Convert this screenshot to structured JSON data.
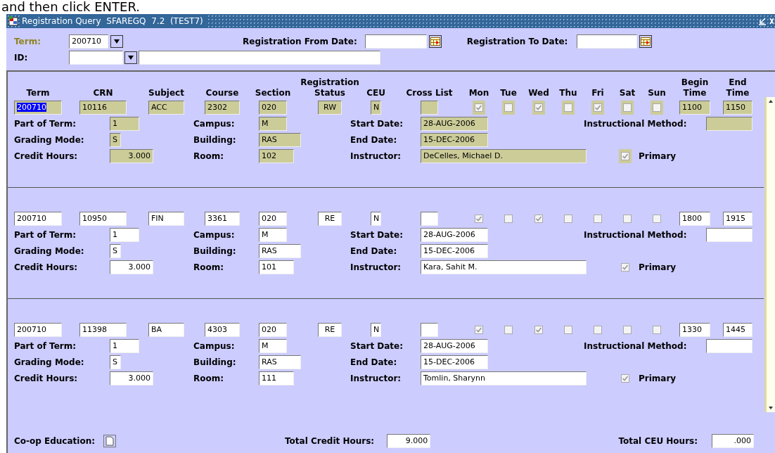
{
  "caption": "and then click ENTER.",
  "window": {
    "title": "Registration Query  SFAREGQ  7.2  (TEST7)"
  },
  "key_block": {
    "term_label": "Term:",
    "term": "200710",
    "id_label": "ID:",
    "from_date_label": "Registration From Date:",
    "to_date_label": "Registration To Date:"
  },
  "columns": [
    {
      "lines": [
        "Term"
      ]
    },
    {
      "lines": [
        "CRN"
      ]
    },
    {
      "lines": [
        "Subject"
      ]
    },
    {
      "lines": [
        "Course"
      ]
    },
    {
      "lines": [
        "Section"
      ]
    },
    {
      "lines": [
        "Registration",
        "Status"
      ]
    },
    {
      "lines": [
        "CEU"
      ]
    },
    {
      "lines": [
        "Cross List"
      ]
    },
    {
      "lines": [
        "Mon"
      ]
    },
    {
      "lines": [
        "Tue"
      ]
    },
    {
      "lines": [
        "Wed"
      ]
    },
    {
      "lines": [
        "Thu"
      ]
    },
    {
      "lines": [
        "Fri"
      ]
    },
    {
      "lines": [
        "Sat"
      ]
    },
    {
      "lines": [
        "Sun"
      ]
    },
    {
      "lines": [
        "Begin",
        "Time"
      ]
    },
    {
      "lines": [
        "End",
        "Time"
      ]
    }
  ],
  "records": [
    {
      "current": true,
      "term": "200710",
      "term_selected": true,
      "crn": "10116",
      "subject": "ACC",
      "course": "2302",
      "section": "020",
      "status": "RW",
      "ceu": "N",
      "days": [
        {
          "checked": true
        },
        {
          "checked": false
        },
        {
          "checked": true
        },
        {
          "checked": false
        },
        {
          "checked": true
        },
        {
          "checked": false
        },
        {
          "checked": false
        }
      ],
      "begin_time": "1100",
      "end_time": "1150",
      "part_of_term": {
        "label": "Part of Term:",
        "value": "1"
      },
      "campus": {
        "label": "Campus:",
        "value": "M"
      },
      "start_date": {
        "label": "Start Date:",
        "value": "28-AUG-2006"
      },
      "instructional_method": {
        "label": "Instructional Method:"
      },
      "grading_mode": {
        "label": "Grading Mode:",
        "value": "S"
      },
      "building": {
        "label": "Building:",
        "value": "RAS"
      },
      "end_date": {
        "label": "End Date:",
        "value": "15-DEC-2006"
      },
      "credit_hours": {
        "label": "Credit Hours:",
        "value": "3.000"
      },
      "room": {
        "label": "Room:",
        "value": "102"
      },
      "instructor": {
        "label": "Instructor:",
        "value": "DeCelles, Michael D."
      },
      "primary": {
        "label": "Primary",
        "checked": true
      }
    },
    {
      "current": false,
      "term": "200710",
      "term_selected": false,
      "crn": "10950",
      "subject": "FIN",
      "course": "3361",
      "section": "020",
      "status": "RE",
      "ceu": "N",
      "days": [
        {
          "checked": true
        },
        {
          "checked": false
        },
        {
          "checked": true
        },
        {
          "checked": false
        },
        {
          "checked": false
        },
        {
          "checked": false
        },
        {
          "checked": false
        }
      ],
      "begin_time": "1800",
      "end_time": "1915",
      "part_of_term": {
        "label": "Part of Term:",
        "value": "1"
      },
      "campus": {
        "label": "Campus:",
        "value": "M"
      },
      "start_date": {
        "label": "Start Date:",
        "value": "28-AUG-2006"
      },
      "instructional_method": {
        "label": "Instructional Method:"
      },
      "grading_mode": {
        "label": "Grading Mode:",
        "value": "S"
      },
      "building": {
        "label": "Building:",
        "value": "RAS"
      },
      "end_date": {
        "label": "End Date:",
        "value": "15-DEC-2006"
      },
      "credit_hours": {
        "label": "Credit Hours:",
        "value": "3.000"
      },
      "room": {
        "label": "Room:",
        "value": "101"
      },
      "instructor": {
        "label": "Instructor:",
        "value": "Kara, Sahit M."
      },
      "primary": {
        "label": "Primary",
        "checked": true
      }
    },
    {
      "current": false,
      "term": "200710",
      "term_selected": false,
      "crn": "11398",
      "subject": "BA",
      "course": "4303",
      "section": "020",
      "status": "RE",
      "ceu": "N",
      "days": [
        {
          "checked": true
        },
        {
          "checked": false
        },
        {
          "checked": true
        },
        {
          "checked": false
        },
        {
          "checked": false
        },
        {
          "checked": false
        },
        {
          "checked": false
        }
      ],
      "begin_time": "1330",
      "end_time": "1445",
      "part_of_term": {
        "label": "Part of Term:",
        "value": "1"
      },
      "campus": {
        "label": "Campus:",
        "value": "M"
      },
      "start_date": {
        "label": "Start Date:",
        "value": "28-AUG-2006"
      },
      "instructional_method": {
        "label": "Instructional Method:"
      },
      "grading_mode": {
        "label": "Grading Mode:",
        "value": "S"
      },
      "building": {
        "label": "Building:",
        "value": "RAS"
      },
      "end_date": {
        "label": "End Date:",
        "value": "15-DEC-2006"
      },
      "credit_hours": {
        "label": "Credit Hours:",
        "value": "3.000"
      },
      "room": {
        "label": "Room:",
        "value": "111"
      },
      "instructor": {
        "label": "Instructor:",
        "value": "Tomlin, Sharynn"
      },
      "primary": {
        "label": "Primary",
        "checked": true
      }
    }
  ],
  "footer": {
    "coop_label": "Co-op Education:",
    "total_credit_label": "Total Credit Hours:",
    "total_credit": "9.000",
    "total_ceu_label": "Total CEU Hours:",
    "total_ceu": ".000"
  }
}
